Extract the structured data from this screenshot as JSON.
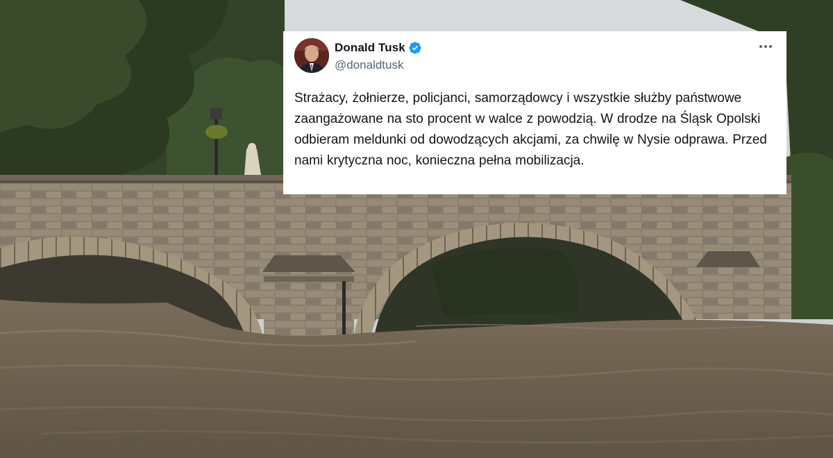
{
  "tweet": {
    "author_name": "Donald Tusk",
    "author_handle": "@donaldtusk",
    "verified": true,
    "verified_color": "#1d9bf0",
    "avatar_icon": "profile-photo",
    "more_icon": "more-horizontal-icon",
    "text": "Strażacy, żołnierze, policjanci, samorządowcy i wszystkie służby państwowe zaangażowane na sto procent w walce z powodzią. W drodze na Śląsk Opolski odbieram meldunki od dowodzących akcjami, za chwilę w Nysie odprawa. Przed nami krytyczna noc, konieczna pełna mobilizacja."
  },
  "colors": {
    "card_background": "#ffffff",
    "text_primary": "#0f1419",
    "text_secondary": "#536471",
    "flood_water": "#6f6250",
    "bridge_stone": "#8d8270"
  }
}
